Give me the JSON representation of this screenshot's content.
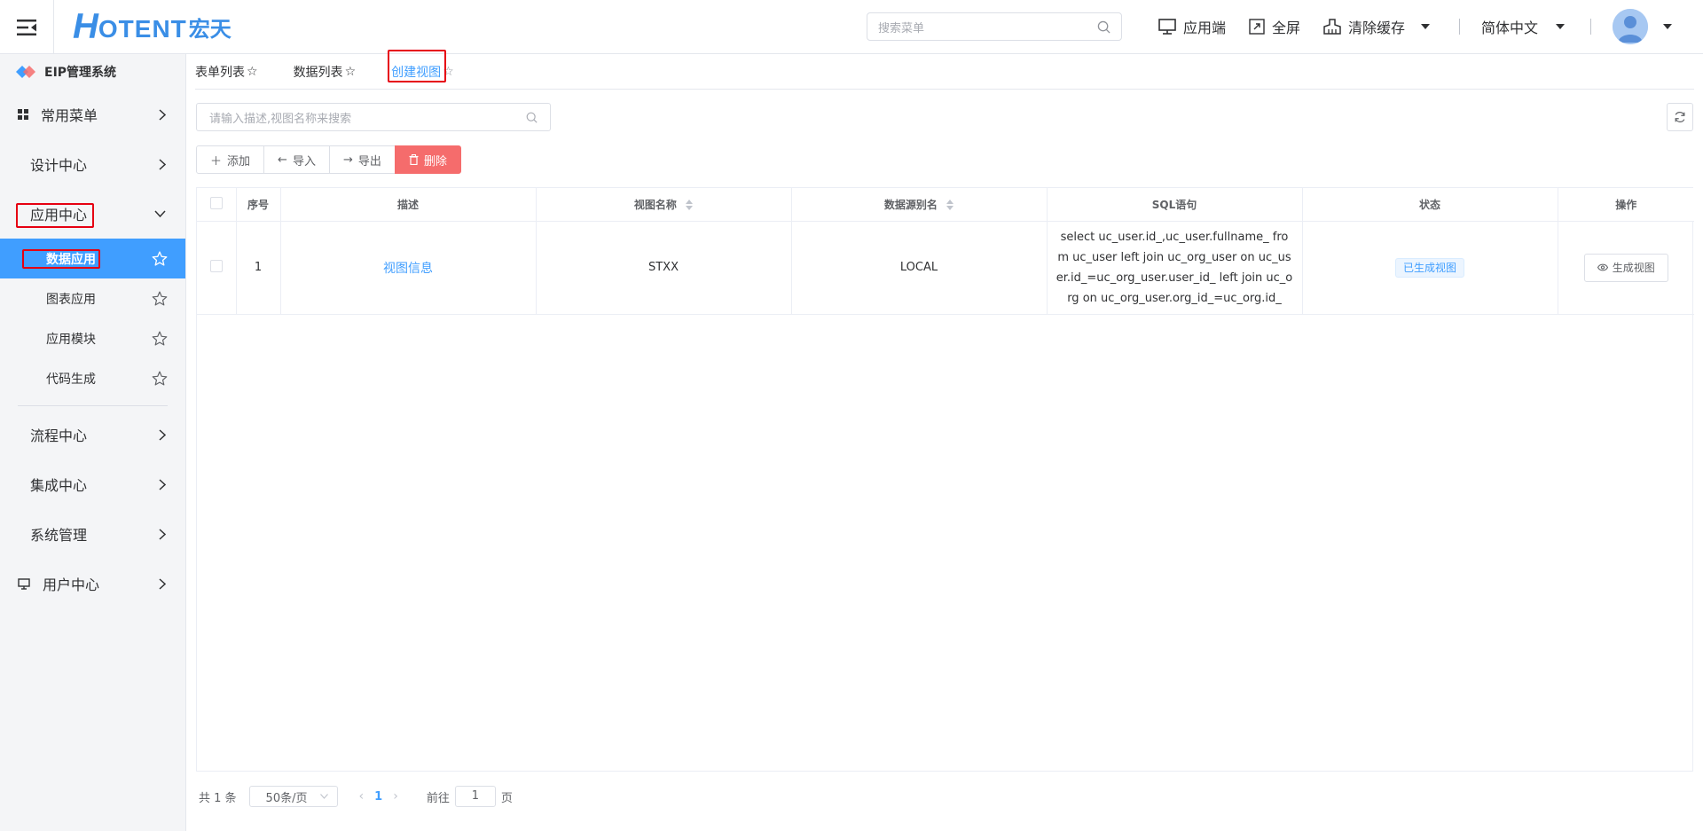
{
  "header": {
    "logo_h": "H",
    "logo_text": "OTENT",
    "logo_cn": "宏天",
    "search_placeholder": "搜索菜单",
    "app_end": "应用端",
    "fullscreen": "全屏",
    "clear_cache": "清除缓存",
    "language": "简体中文"
  },
  "sidebar": {
    "system_title": "EIP管理系统",
    "items": [
      {
        "label": "常用菜单"
      },
      {
        "label": "设计中心"
      },
      {
        "label": "应用中心"
      },
      {
        "label": "流程中心"
      },
      {
        "label": "集成中心"
      },
      {
        "label": "系统管理"
      },
      {
        "label": "用户中心"
      }
    ],
    "sub_items": [
      {
        "label": "数据应用"
      },
      {
        "label": "图表应用"
      },
      {
        "label": "应用模块"
      },
      {
        "label": "代码生成"
      }
    ]
  },
  "tabs": [
    {
      "label": "表单列表"
    },
    {
      "label": "数据列表"
    },
    {
      "label": "创建视图"
    }
  ],
  "toolbar": {
    "search_placeholder": "请输入描述,视图名称来搜索",
    "add": "添加",
    "import": "导入",
    "export": "导出",
    "delete": "删除"
  },
  "table": {
    "headers": [
      "序号",
      "描述",
      "视图名称",
      "数据源别名",
      "SQL语句",
      "状态",
      "操作"
    ],
    "rows": [
      {
        "index": "1",
        "desc": "视图信息",
        "view_name": "STXX",
        "datasource": "LOCAL",
        "sql": "select uc_user.id_,uc_user.fullname_ from uc_user left join uc_org_user on uc_user.id_=uc_org_user.user_id_ left join uc_org on uc_org_user.org_id_=uc_org.id_",
        "status": "已生成视图",
        "action": "生成视图"
      }
    ]
  },
  "pagination": {
    "total": "共 1 条",
    "page_size": "50条/页",
    "current": "1",
    "goto_label": "前往",
    "goto_value": "1",
    "page_unit": "页"
  },
  "colors": {
    "primary": "#409eff",
    "danger": "#f56c6c",
    "highlight_box": "#e60012"
  }
}
